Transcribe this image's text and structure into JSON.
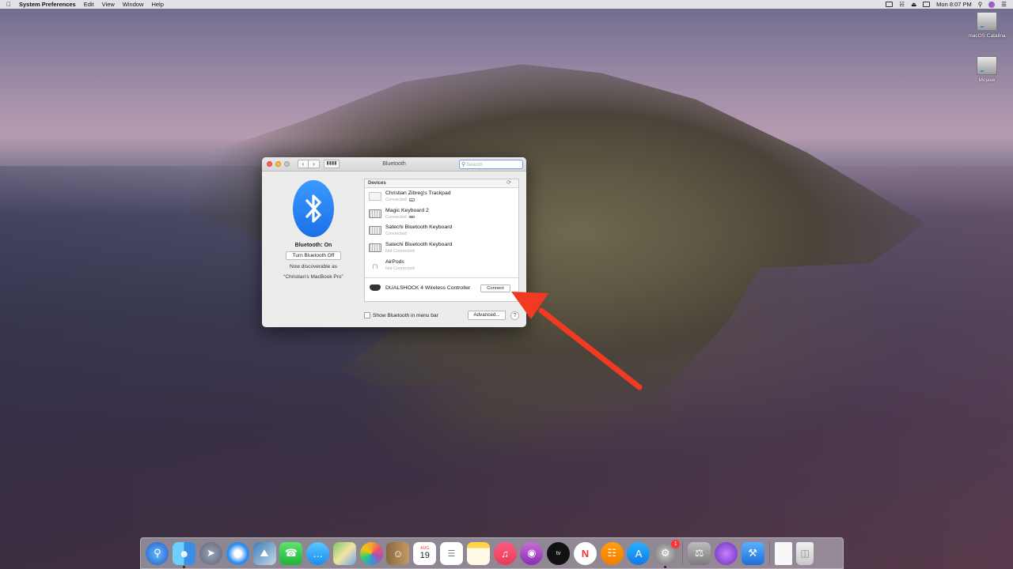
{
  "menubar": {
    "app_name": "System Preferences",
    "items": [
      "Edit",
      "View",
      "Window",
      "Help"
    ],
    "clock": "Mon 8:07 PM"
  },
  "desktop": {
    "icons": [
      {
        "label": "macOS Catalina",
        "icon": "hard-drive-icon"
      },
      {
        "label": "Mojave",
        "icon": "hard-drive-icon"
      }
    ]
  },
  "window": {
    "title": "Bluetooth",
    "search_placeholder": "Search",
    "bluetooth_status": "Bluetooth: On",
    "toggle_label": "Turn Bluetooth Off",
    "discoverable_line1": "Now discoverable as",
    "discoverable_line2": "“Christian’s MacBook Pro”",
    "devices_header": "Devices",
    "devices": [
      {
        "name": "Christian Zibreg's Trackpad",
        "status": "Connected",
        "icon": "trackpad-icon",
        "battery": true
      },
      {
        "name": "Magic Keyboard 2",
        "status": "Connected",
        "icon": "keyboard-icon",
        "battery": true
      },
      {
        "name": "Satechi Bluetooth Keyboard",
        "status": "Connected",
        "icon": "keyboard-icon",
        "battery": false
      },
      {
        "name": "Satechi Bluetooth Keyboard",
        "status": "Not Connected",
        "icon": "keyboard-icon",
        "battery": false
      },
      {
        "name": "AirPods",
        "status": "Not Connected",
        "icon": "airpods-icon",
        "battery": false
      }
    ],
    "controller": {
      "name": "DUALSHOCK 4 Wireless Controller",
      "button": "Connect"
    },
    "show_in_menubar_label": "Show Bluetooth in menu bar",
    "advanced_label": "Advanced...",
    "help_label": "?"
  },
  "dock": {
    "calendar_month": "AUG",
    "calendar_day": "19",
    "sysprefs_badge": "1",
    "tv_label": "tv"
  },
  "colors": {
    "bluetooth_blue": "#2a86f5",
    "annotation_arrow": "#f23a22",
    "search_focus": "#6fa0e8"
  }
}
